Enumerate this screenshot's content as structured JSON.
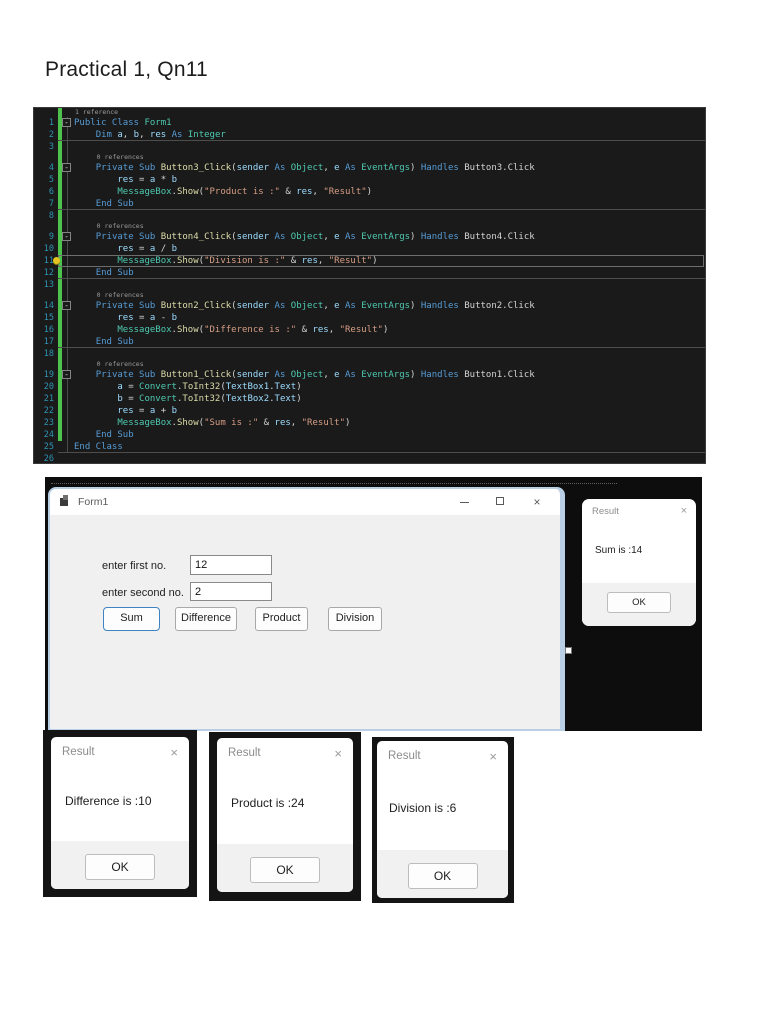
{
  "page": {
    "title": "Practical 1, Qn11"
  },
  "colors": {
    "editor_bg": "#1a1a1a",
    "keyword": "#569cd6",
    "type": "#4ec9b0",
    "method": "#dcdcaa",
    "variable": "#9cdcfe",
    "string": "#d69d85",
    "plain": "#d4d4d4",
    "line_number": "#2e94b5",
    "change_bar_green": "#4dc24d",
    "focus_accent": "#4083c2",
    "form_border": "#b9cfe6"
  },
  "icons": {
    "close": "×",
    "lightbulb": "lightbulb-icon",
    "form": "form-window-icon"
  },
  "code_editor": {
    "lines": [
      {
        "n": 1,
        "ref": "1 reference",
        "fold": true,
        "tokens": [
          [
            "k",
            "Public Class "
          ],
          [
            "t",
            "Form1"
          ]
        ]
      },
      {
        "n": 2,
        "sep": true,
        "tokens": [
          [
            "p",
            "    "
          ],
          [
            "k",
            "Dim "
          ],
          [
            "v",
            "a"
          ],
          [
            "p",
            ", "
          ],
          [
            "v",
            "b"
          ],
          [
            "p",
            ", "
          ],
          [
            "v",
            "res "
          ],
          [
            "k",
            "As "
          ],
          [
            "t",
            "Integer"
          ]
        ]
      },
      {
        "n": 3,
        "tokens": []
      },
      {
        "n": 4,
        "ref": "0 references",
        "fold": true,
        "tokens": [
          [
            "p",
            "    "
          ],
          [
            "k",
            "Private Sub "
          ],
          [
            "m",
            "Button3_Click"
          ],
          [
            "p",
            "("
          ],
          [
            "v",
            "sender "
          ],
          [
            "k",
            "As "
          ],
          [
            "t",
            "Object"
          ],
          [
            "p",
            ", "
          ],
          [
            "v",
            "e "
          ],
          [
            "k",
            "As "
          ],
          [
            "t",
            "EventArgs"
          ],
          [
            "p",
            ") "
          ],
          [
            "k",
            "Handles "
          ],
          [
            "p",
            "Button3.Click"
          ]
        ]
      },
      {
        "n": 5,
        "tokens": [
          [
            "p",
            "        "
          ],
          [
            "v",
            "res"
          ],
          [
            "p",
            " = "
          ],
          [
            "v",
            "a"
          ],
          [
            "p",
            " * "
          ],
          [
            "v",
            "b"
          ]
        ]
      },
      {
        "n": 6,
        "tokens": [
          [
            "p",
            "        "
          ],
          [
            "t",
            "MessageBox"
          ],
          [
            "p",
            "."
          ],
          [
            "m",
            "Show"
          ],
          [
            "p",
            "("
          ],
          [
            "s",
            "\"Product is :\""
          ],
          [
            "p",
            " & "
          ],
          [
            "v",
            "res"
          ],
          [
            "p",
            ", "
          ],
          [
            "s",
            "\"Result\""
          ],
          [
            "p",
            ")"
          ]
        ]
      },
      {
        "n": 7,
        "sep": true,
        "tokens": [
          [
            "p",
            "    "
          ],
          [
            "k",
            "End Sub"
          ]
        ]
      },
      {
        "n": 8,
        "tokens": []
      },
      {
        "n": 9,
        "ref": "0 references",
        "fold": true,
        "tokens": [
          [
            "p",
            "    "
          ],
          [
            "k",
            "Private Sub "
          ],
          [
            "m",
            "Button4_Click"
          ],
          [
            "p",
            "("
          ],
          [
            "v",
            "sender "
          ],
          [
            "k",
            "As "
          ],
          [
            "t",
            "Object"
          ],
          [
            "p",
            ", "
          ],
          [
            "v",
            "e "
          ],
          [
            "k",
            "As "
          ],
          [
            "t",
            "EventArgs"
          ],
          [
            "p",
            ") "
          ],
          [
            "k",
            "Handles "
          ],
          [
            "p",
            "Button4.Click"
          ]
        ]
      },
      {
        "n": 10,
        "tokens": [
          [
            "p",
            "        "
          ],
          [
            "v",
            "res"
          ],
          [
            "p",
            " = "
          ],
          [
            "v",
            "a"
          ],
          [
            "p",
            " / "
          ],
          [
            "v",
            "b"
          ]
        ]
      },
      {
        "n": 11,
        "hl": true,
        "bulb": true,
        "tokens": [
          [
            "p",
            "        "
          ],
          [
            "t",
            "MessageBox"
          ],
          [
            "p",
            "."
          ],
          [
            "m",
            "Show"
          ],
          [
            "p",
            "("
          ],
          [
            "s",
            "\"Division is :\""
          ],
          [
            "p",
            " & "
          ],
          [
            "v",
            "res"
          ],
          [
            "p",
            ", "
          ],
          [
            "s",
            "\"Result\""
          ],
          [
            "p",
            ")"
          ]
        ]
      },
      {
        "n": 12,
        "sep": true,
        "tokens": [
          [
            "p",
            "    "
          ],
          [
            "k",
            "End Sub"
          ]
        ]
      },
      {
        "n": 13,
        "tokens": []
      },
      {
        "n": 14,
        "ref": "0 references",
        "fold": true,
        "tokens": [
          [
            "p",
            "    "
          ],
          [
            "k",
            "Private Sub "
          ],
          [
            "m",
            "Button2_Click"
          ],
          [
            "p",
            "("
          ],
          [
            "v",
            "sender "
          ],
          [
            "k",
            "As "
          ],
          [
            "t",
            "Object"
          ],
          [
            "p",
            ", "
          ],
          [
            "v",
            "e "
          ],
          [
            "k",
            "As "
          ],
          [
            "t",
            "EventArgs"
          ],
          [
            "p",
            ") "
          ],
          [
            "k",
            "Handles "
          ],
          [
            "p",
            "Button2.Click"
          ]
        ]
      },
      {
        "n": 15,
        "tokens": [
          [
            "p",
            "        "
          ],
          [
            "v",
            "res"
          ],
          [
            "p",
            " = "
          ],
          [
            "v",
            "a"
          ],
          [
            "p",
            " - "
          ],
          [
            "v",
            "b"
          ]
        ]
      },
      {
        "n": 16,
        "tokens": [
          [
            "p",
            "        "
          ],
          [
            "t",
            "MessageBox"
          ],
          [
            "p",
            "."
          ],
          [
            "m",
            "Show"
          ],
          [
            "p",
            "("
          ],
          [
            "s",
            "\"Difference is :\""
          ],
          [
            "p",
            " & "
          ],
          [
            "v",
            "res"
          ],
          [
            "p",
            ", "
          ],
          [
            "s",
            "\"Result\""
          ],
          [
            "p",
            ")"
          ]
        ]
      },
      {
        "n": 17,
        "sep": true,
        "tokens": [
          [
            "p",
            "    "
          ],
          [
            "k",
            "End Sub"
          ]
        ]
      },
      {
        "n": 18,
        "tokens": []
      },
      {
        "n": 19,
        "ref": "0 references",
        "fold": true,
        "tokens": [
          [
            "p",
            "    "
          ],
          [
            "k",
            "Private Sub "
          ],
          [
            "m",
            "Button1_Click"
          ],
          [
            "p",
            "("
          ],
          [
            "v",
            "sender "
          ],
          [
            "k",
            "As "
          ],
          [
            "t",
            "Object"
          ],
          [
            "p",
            ", "
          ],
          [
            "v",
            "e "
          ],
          [
            "k",
            "As "
          ],
          [
            "t",
            "EventArgs"
          ],
          [
            "p",
            ") "
          ],
          [
            "k",
            "Handles "
          ],
          [
            "p",
            "Button1.Click"
          ]
        ]
      },
      {
        "n": 20,
        "tokens": [
          [
            "p",
            "        "
          ],
          [
            "v",
            "a"
          ],
          [
            "p",
            " = "
          ],
          [
            "t",
            "Convert"
          ],
          [
            "p",
            "."
          ],
          [
            "m",
            "ToInt32"
          ],
          [
            "p",
            "("
          ],
          [
            "v",
            "TextBox1"
          ],
          [
            "p",
            "."
          ],
          [
            "v",
            "Text"
          ],
          [
            "p",
            ")"
          ]
        ]
      },
      {
        "n": 21,
        "tokens": [
          [
            "p",
            "        "
          ],
          [
            "v",
            "b"
          ],
          [
            "p",
            " = "
          ],
          [
            "t",
            "Convert"
          ],
          [
            "p",
            "."
          ],
          [
            "m",
            "ToInt32"
          ],
          [
            "p",
            "("
          ],
          [
            "v",
            "TextBox2"
          ],
          [
            "p",
            "."
          ],
          [
            "v",
            "Text"
          ],
          [
            "p",
            ")"
          ]
        ]
      },
      {
        "n": 22,
        "tokens": [
          [
            "p",
            "        "
          ],
          [
            "v",
            "res"
          ],
          [
            "p",
            " = "
          ],
          [
            "v",
            "a"
          ],
          [
            "p",
            " + "
          ],
          [
            "v",
            "b"
          ]
        ]
      },
      {
        "n": 23,
        "tokens": [
          [
            "p",
            "        "
          ],
          [
            "t",
            "MessageBox"
          ],
          [
            "p",
            "."
          ],
          [
            "m",
            "Show"
          ],
          [
            "p",
            "("
          ],
          [
            "s",
            "\"Sum is :\""
          ],
          [
            "p",
            " & "
          ],
          [
            "v",
            "res"
          ],
          [
            "p",
            ", "
          ],
          [
            "s",
            "\"Result\""
          ],
          [
            "p",
            ")"
          ]
        ]
      },
      {
        "n": 24,
        "tokens": [
          [
            "p",
            "    "
          ],
          [
            "k",
            "End Sub"
          ]
        ]
      },
      {
        "n": 25,
        "sep": true,
        "tokens": [
          [
            "k",
            "End Class"
          ]
        ]
      },
      {
        "n": 26,
        "tokens": []
      }
    ]
  },
  "designer": {
    "form": {
      "title": "Form1",
      "labels": [
        "enter first no.",
        "enter second no."
      ],
      "inputs": [
        "12",
        "2"
      ],
      "buttons": [
        "Sum",
        "Difference",
        "Product",
        "Division"
      ]
    },
    "result_dialog": {
      "title": "Result",
      "message": "Sum is :14",
      "ok": "OK"
    }
  },
  "dialogs": [
    {
      "title": "Result",
      "message": "Difference is :10",
      "ok": "OK"
    },
    {
      "title": "Result",
      "message": "Product is :24",
      "ok": "OK"
    },
    {
      "title": "Result",
      "message": "Division is :6",
      "ok": "OK"
    }
  ]
}
